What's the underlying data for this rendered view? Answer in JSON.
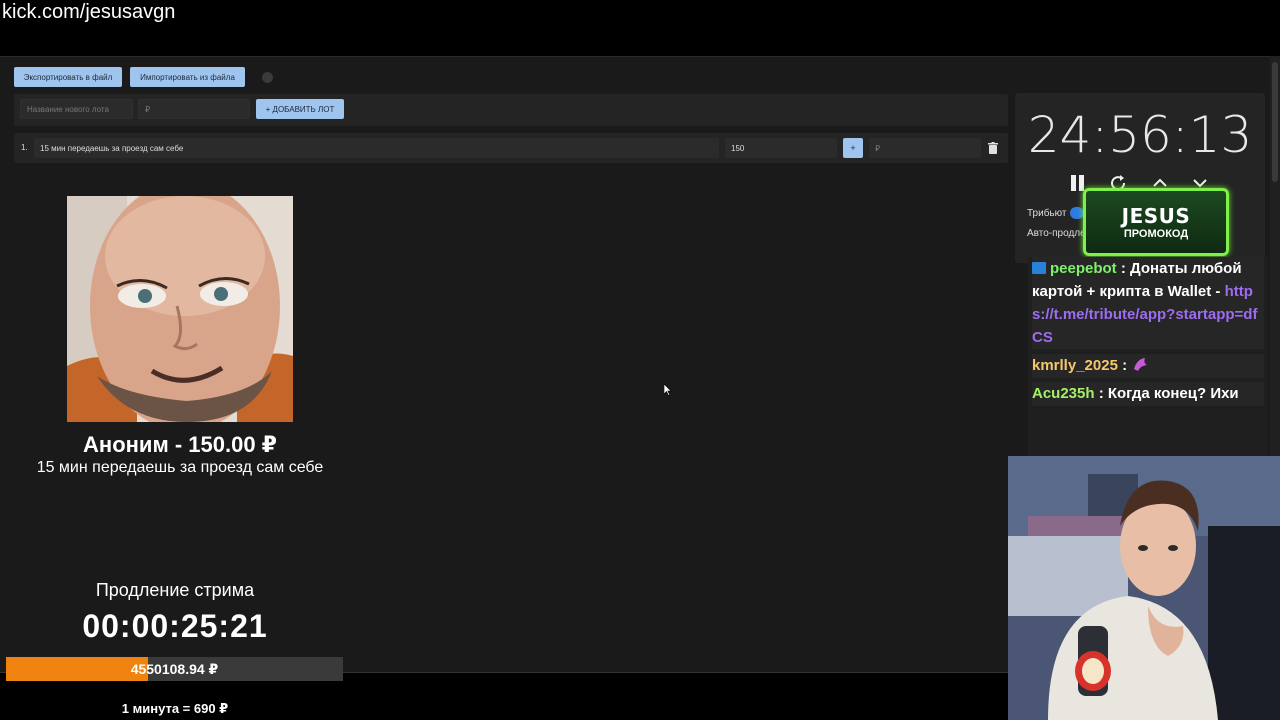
{
  "browser": {
    "url": "kick.com/jesusavgn"
  },
  "toolbar": {
    "export_label": "Экспортировать в файл",
    "import_label": "Импортировать из файла"
  },
  "add_lot": {
    "name_placeholder": "Название нового лота",
    "amount_placeholder": "₽",
    "add_label": "+ ДОБАВИТЬ ЛОТ"
  },
  "lots": [
    {
      "index": "1.",
      "name": "15 мин передаешь за проезд сам себе",
      "amount": "150",
      "plus_label": "+",
      "extra_placeholder": "₽"
    }
  ],
  "winner": {
    "title": "Аноним - 150.00 ₽",
    "lot": "15 мин передаешь за проезд сам себе"
  },
  "extension": {
    "title": "Продление стрима",
    "timer": "00:00:25:21",
    "amount": "4550108.94 ₽",
    "progress": 0.42,
    "rate": "1 минута = 690 ₽"
  },
  "timer_panel": {
    "time": "24:56:13",
    "tribute_label": "Трибьют",
    "auto_label": "Авто-продле"
  },
  "promo": {
    "title": "JESUS",
    "subtitle": "ПРОМОКОД"
  },
  "chat": [
    {
      "user": "peepebot",
      "text": " : Донаты любой картой + крипта в Wallet - ",
      "link": "https://t.me/tribute/app?startapp=dfCS"
    },
    {
      "user": "kmrlly_2025",
      "text": " : "
    },
    {
      "user": "Acu235h",
      "text": " : Когда конец? Ихи"
    }
  ],
  "colors": {
    "accent_button": "#9fc4ee",
    "progress_fill": "#f0820f",
    "promo_border": "#7ff04a"
  }
}
